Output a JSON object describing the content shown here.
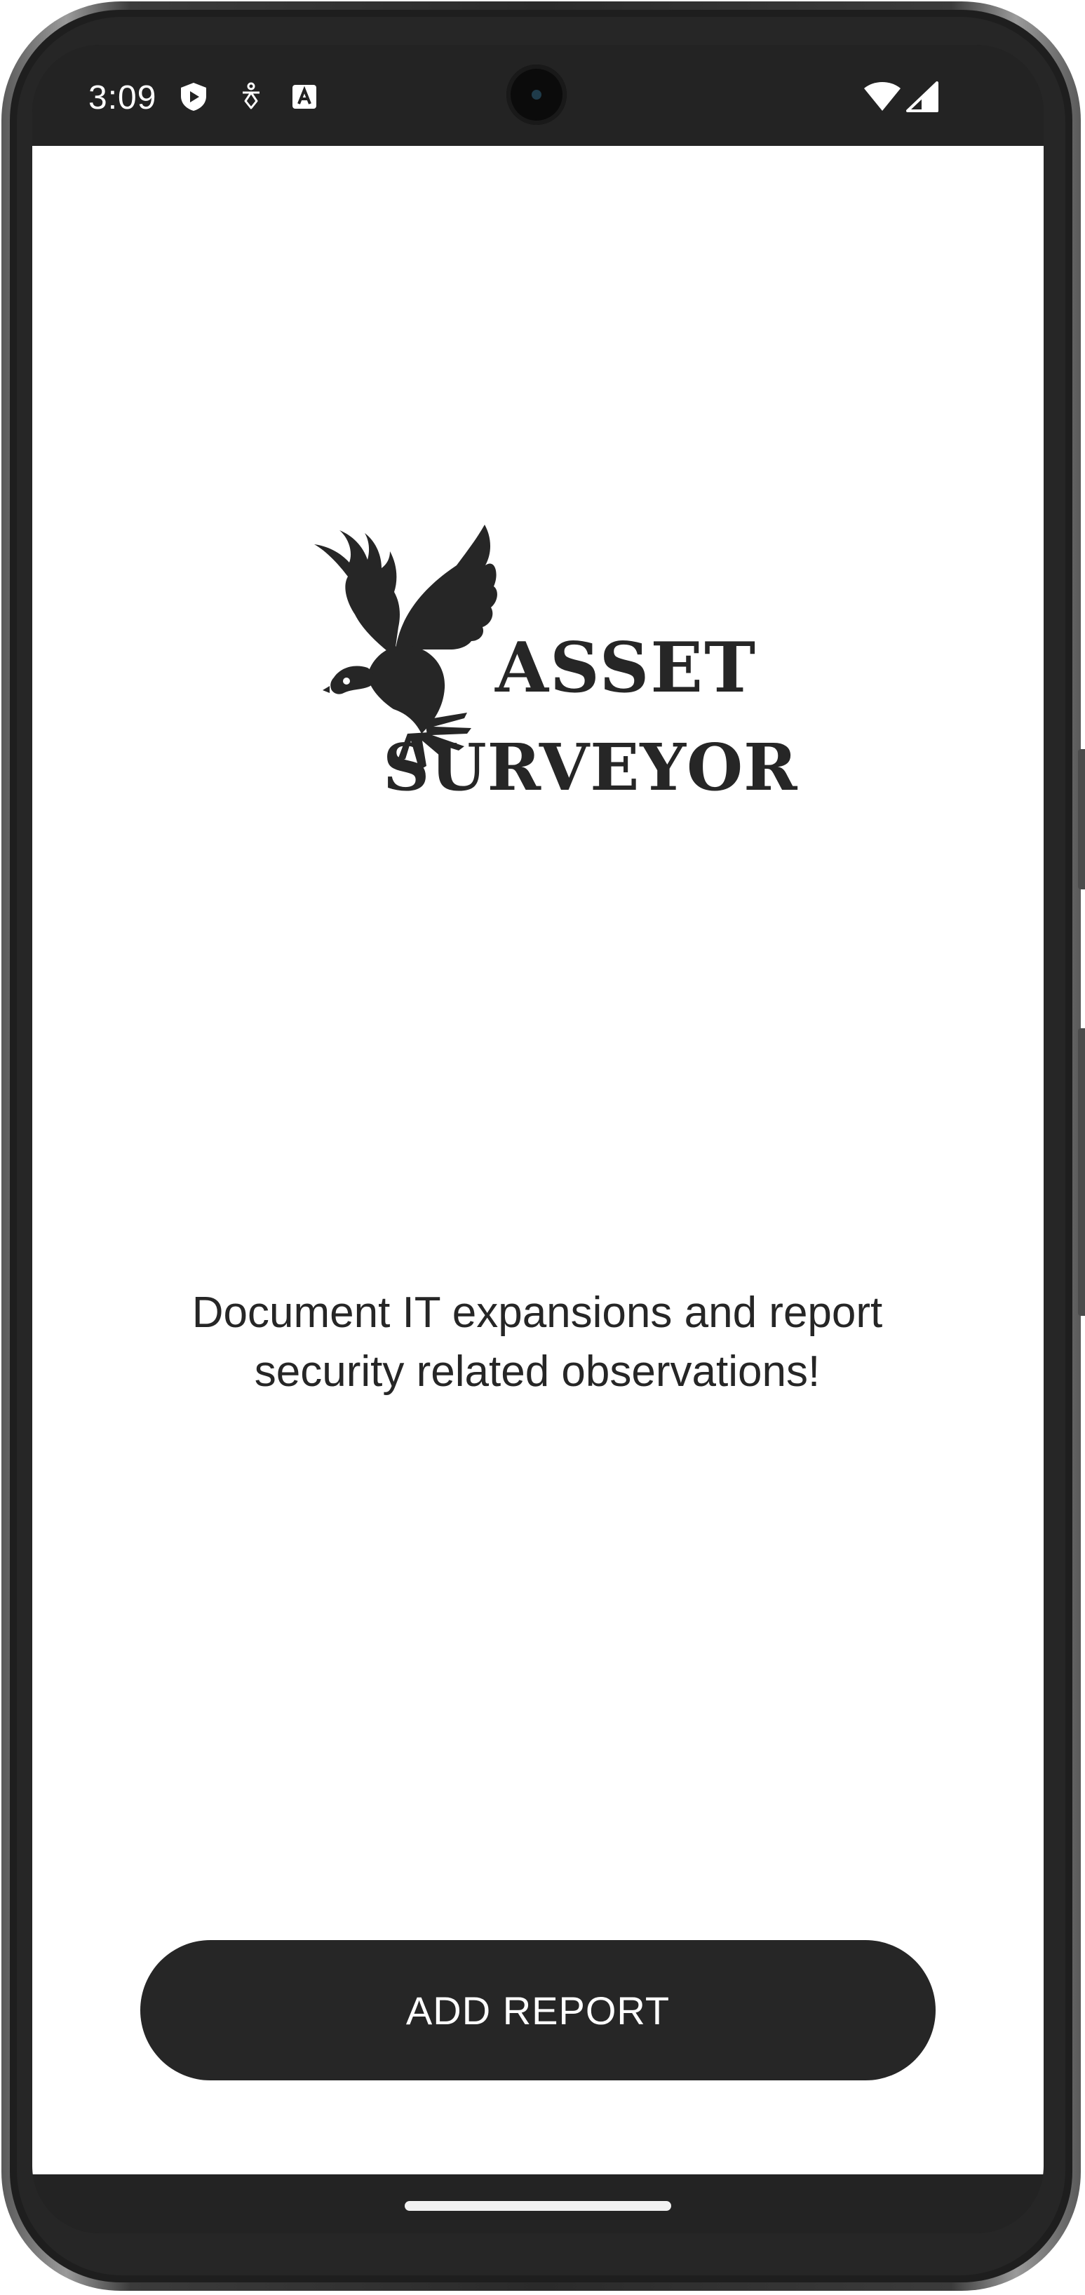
{
  "status_bar": {
    "time": "3:09",
    "left_icons": [
      "shield-play-icon",
      "accessibility-icon",
      "text-a-icon"
    ],
    "right_icons": [
      "wifi-icon",
      "cell-signal-icon"
    ]
  },
  "logo": {
    "line1": "ASSET",
    "line2": "SURVEYOR",
    "emblem": "eagle-icon"
  },
  "tagline": "Document IT expansions and report security related observations!",
  "actions": {
    "add_report_label": "ADD REPORT"
  },
  "colors": {
    "primary": "#262626",
    "background": "#ffffff",
    "on_primary": "#ffffff"
  }
}
